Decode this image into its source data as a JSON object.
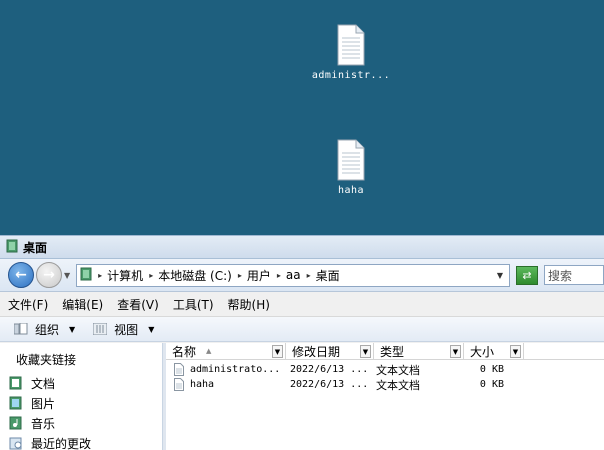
{
  "desktop": {
    "icons": [
      {
        "label": "administr..."
      },
      {
        "label": "haha"
      }
    ]
  },
  "window": {
    "title": "桌面",
    "address": {
      "crumbs": [
        "计算机",
        "本地磁盘 (C:)",
        "用户",
        "aa",
        "桌面"
      ]
    },
    "search_placeholder": "搜索",
    "menu": [
      "文件(F)",
      "编辑(E)",
      "查看(V)",
      "工具(T)",
      "帮助(H)"
    ],
    "toolbar": {
      "organize": "组织",
      "views": "视图"
    },
    "nav_pane": {
      "header": "收藏夹链接",
      "items": [
        "文档",
        "图片",
        "音乐",
        "最近的更改"
      ]
    },
    "columns": [
      "名称",
      "修改日期",
      "类型",
      "大小"
    ],
    "files": [
      {
        "name": "administrato...",
        "date": "2022/6/13 ...",
        "type": "文本文档",
        "size": "0 KB"
      },
      {
        "name": "haha",
        "date": "2022/6/13 ...",
        "type": "文本文档",
        "size": "0 KB"
      }
    ]
  },
  "colors": {
    "desktop_bg": "#1e5f7e",
    "accent": "#2b6fc1"
  }
}
